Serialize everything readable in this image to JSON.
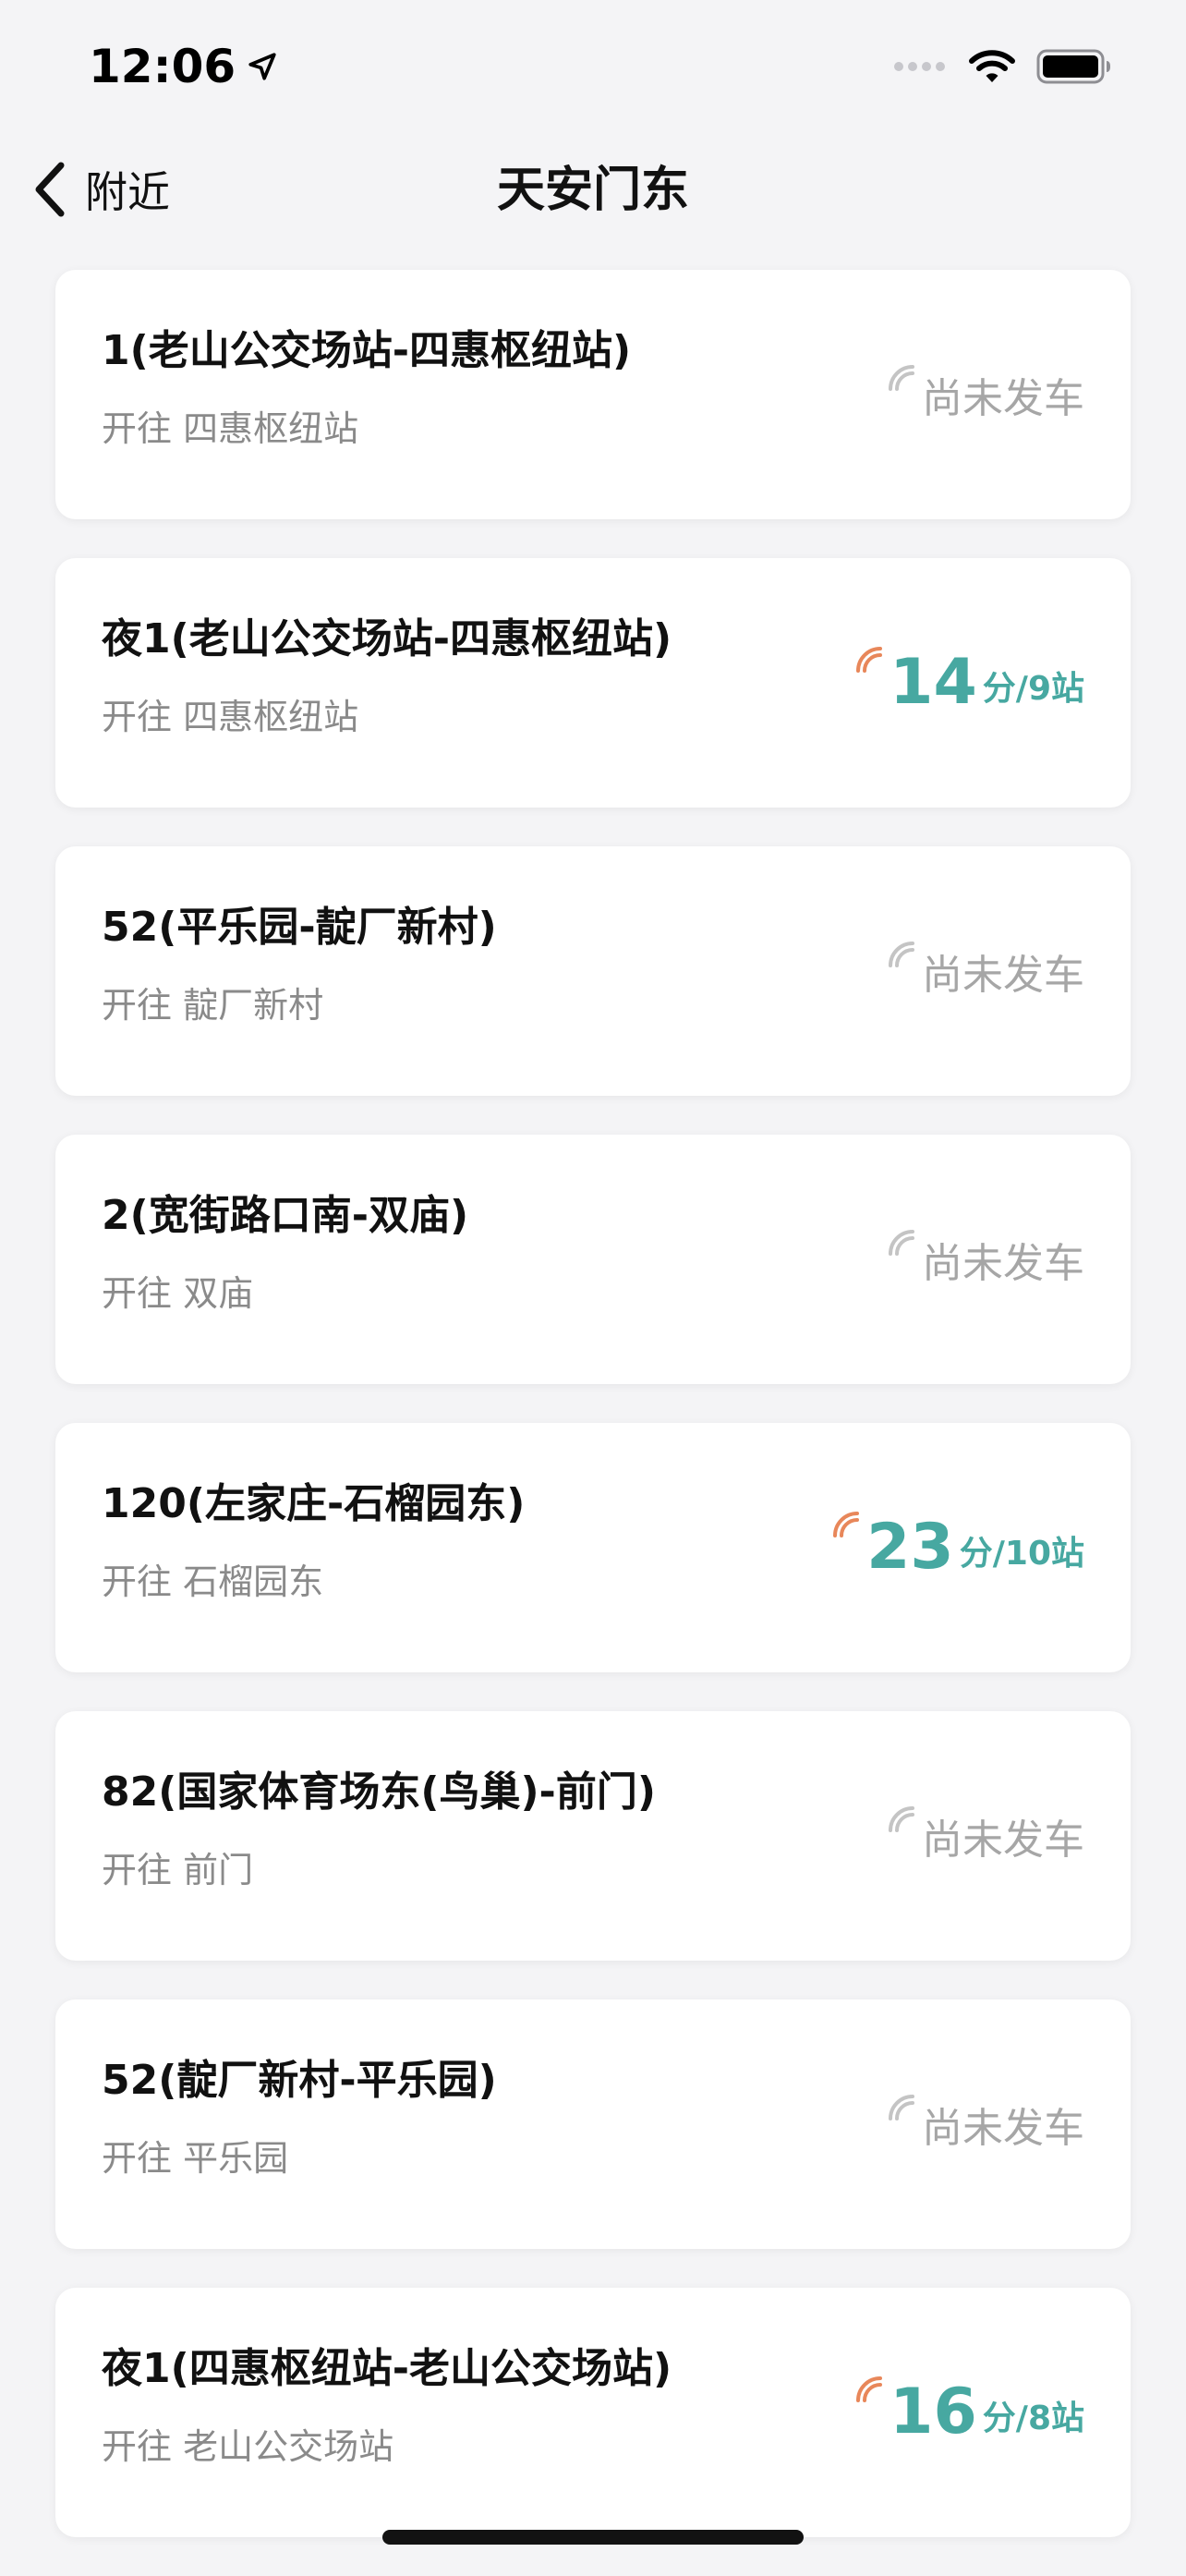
{
  "status_bar": {
    "time": "12:06"
  },
  "nav": {
    "back_label": "附近",
    "title": "天安门东"
  },
  "routes": [
    {
      "name": "1(老山公交场站-四惠枢纽站)",
      "direction": "开往 四惠枢纽站",
      "status": "尚未发车",
      "minutes": "",
      "unit": ""
    },
    {
      "name": "夜1(老山公交场站-四惠枢纽站)",
      "direction": "开往 四惠枢纽站",
      "status": "",
      "minutes": "14",
      "unit": "分/9站"
    },
    {
      "name": "52(平乐园-靛厂新村)",
      "direction": "开往 靛厂新村",
      "status": "尚未发车",
      "minutes": "",
      "unit": ""
    },
    {
      "name": "2(宽街路口南-双庙)",
      "direction": "开往 双庙",
      "status": "尚未发车",
      "minutes": "",
      "unit": ""
    },
    {
      "name": "120(左家庄-石榴园东)",
      "direction": "开往 石榴园东",
      "status": "",
      "minutes": "23",
      "unit": "分/10站"
    },
    {
      "name": "82(国家体育场东(鸟巢)-前门)",
      "direction": "开往 前门",
      "status": "尚未发车",
      "minutes": "",
      "unit": ""
    },
    {
      "name": "52(靛厂新村-平乐园)",
      "direction": "开往 平乐园",
      "status": "尚未发车",
      "minutes": "",
      "unit": ""
    },
    {
      "name": "夜1(四惠枢纽站-老山公交场站)",
      "direction": "开往 老山公交场站",
      "status": "",
      "minutes": "16",
      "unit": "分/8站"
    }
  ],
  "colors": {
    "eta": "#47a8a1",
    "signal_live": "#e8875a",
    "signal_idle": "#c4c4c4",
    "muted_text": "#8a8a8a"
  },
  "icons": {
    "back": "chevron-left-icon",
    "location": "location-arrow-icon",
    "signal": "cellular-signal-icon",
    "wifi": "wifi-icon",
    "battery": "battery-icon",
    "realtime": "realtime-signal-icon"
  }
}
